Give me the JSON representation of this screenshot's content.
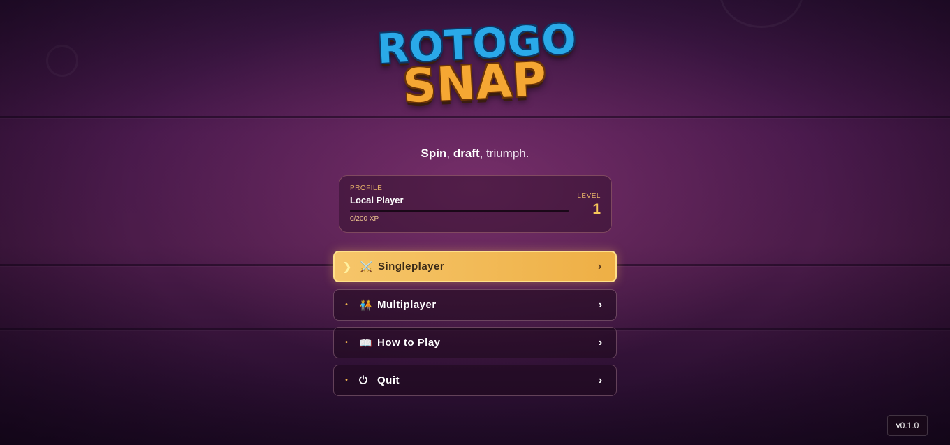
{
  "logo": {
    "line1": "ROTOGO",
    "line2": "SNAP"
  },
  "tagline": {
    "word1": "Spin",
    "sep1": ", ",
    "word2": "draft",
    "rest": ", triumph."
  },
  "profile": {
    "label": "PROFILE",
    "name": "Local Player",
    "xp_text": "0/200 XP",
    "xp_fraction": 0,
    "level_label": "LEVEL",
    "level": "1"
  },
  "menu": [
    {
      "label": "Singleplayer",
      "icon": "crossed-swords-icon",
      "glyph": "⚔️",
      "active": true,
      "chevron": "›",
      "marker": "❯"
    },
    {
      "label": "Multiplayer",
      "icon": "two-people-icon",
      "glyph": "🧑‍🤝‍🧑",
      "active": false,
      "chevron": "›",
      "marker": "•"
    },
    {
      "label": "How to Play",
      "icon": "open-book-icon",
      "glyph": "📖",
      "active": false,
      "chevron": "›",
      "marker": "•"
    },
    {
      "label": "Quit",
      "icon": "power-icon",
      "glyph": "⏻",
      "active": false,
      "chevron": "›",
      "marker": "•"
    }
  ],
  "version": "v0.1.0",
  "colors": {
    "accent": "#f2b64e",
    "active_button": "#f3bb55",
    "logo_blue": "#2aa9e8",
    "logo_orange": "#f5a733"
  }
}
